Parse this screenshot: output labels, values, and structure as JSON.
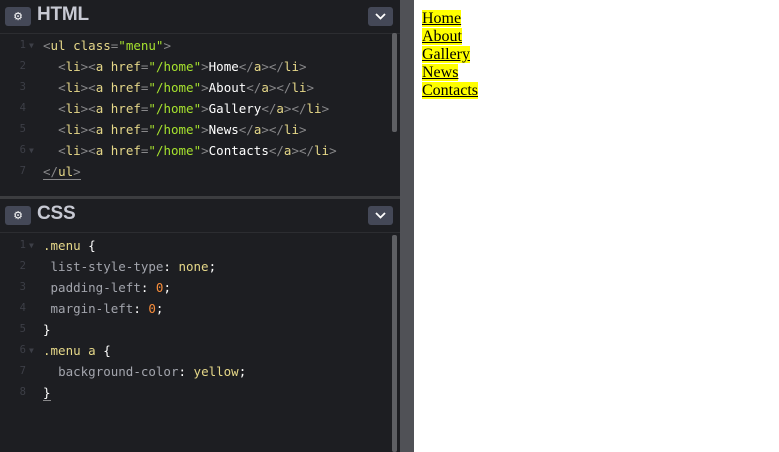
{
  "html_panel": {
    "title": "HTML",
    "gear_icon": "gear-icon",
    "collapse_icon": "chevron-down-icon",
    "line_numbers": [
      "1",
      "2",
      "3",
      "4",
      "5",
      "6",
      "7"
    ],
    "lines": [
      [
        {
          "c": "t-tag",
          "t": "<"
        },
        {
          "c": "t-name",
          "t": "ul"
        },
        {
          "c": "t-text",
          "t": " "
        },
        {
          "c": "t-attr",
          "t": "class"
        },
        {
          "c": "t-eq",
          "t": "="
        },
        {
          "c": "t-str",
          "t": "\"menu\""
        },
        {
          "c": "t-tag",
          "t": ">"
        }
      ],
      [
        {
          "c": "t-text",
          "t": "  "
        },
        {
          "c": "t-tag",
          "t": "<"
        },
        {
          "c": "t-name",
          "t": "li"
        },
        {
          "c": "t-tag",
          "t": "><"
        },
        {
          "c": "t-name",
          "t": "a"
        },
        {
          "c": "t-text",
          "t": " "
        },
        {
          "c": "t-attr",
          "t": "href"
        },
        {
          "c": "t-eq",
          "t": "="
        },
        {
          "c": "t-str",
          "t": "\"/home\""
        },
        {
          "c": "t-tag",
          "t": ">"
        },
        {
          "c": "t-text",
          "t": "Home"
        },
        {
          "c": "t-tag",
          "t": "</"
        },
        {
          "c": "t-name",
          "t": "a"
        },
        {
          "c": "t-tag",
          "t": "></"
        },
        {
          "c": "t-name",
          "t": "li"
        },
        {
          "c": "t-tag",
          "t": ">"
        }
      ],
      [
        {
          "c": "t-text",
          "t": "  "
        },
        {
          "c": "t-tag",
          "t": "<"
        },
        {
          "c": "t-name",
          "t": "li"
        },
        {
          "c": "t-tag",
          "t": "><"
        },
        {
          "c": "t-name",
          "t": "a"
        },
        {
          "c": "t-text",
          "t": " "
        },
        {
          "c": "t-attr",
          "t": "href"
        },
        {
          "c": "t-eq",
          "t": "="
        },
        {
          "c": "t-str",
          "t": "\"/home\""
        },
        {
          "c": "t-tag",
          "t": ">"
        },
        {
          "c": "t-text",
          "t": "About"
        },
        {
          "c": "t-tag",
          "t": "</"
        },
        {
          "c": "t-name",
          "t": "a"
        },
        {
          "c": "t-tag",
          "t": "></"
        },
        {
          "c": "t-name",
          "t": "li"
        },
        {
          "c": "t-tag",
          "t": ">"
        }
      ],
      [
        {
          "c": "t-text",
          "t": "  "
        },
        {
          "c": "t-tag",
          "t": "<"
        },
        {
          "c": "t-name",
          "t": "li"
        },
        {
          "c": "t-tag",
          "t": "><"
        },
        {
          "c": "t-name",
          "t": "a"
        },
        {
          "c": "t-text",
          "t": " "
        },
        {
          "c": "t-attr",
          "t": "href"
        },
        {
          "c": "t-eq",
          "t": "="
        },
        {
          "c": "t-str",
          "t": "\"/home\""
        },
        {
          "c": "t-tag",
          "t": ">"
        },
        {
          "c": "t-text",
          "t": "Gallery"
        },
        {
          "c": "t-tag",
          "t": "</"
        },
        {
          "c": "t-name",
          "t": "a"
        },
        {
          "c": "t-tag",
          "t": "></"
        },
        {
          "c": "t-name",
          "t": "li"
        },
        {
          "c": "t-tag",
          "t": ">"
        }
      ],
      [
        {
          "c": "t-text",
          "t": "  "
        },
        {
          "c": "t-tag",
          "t": "<"
        },
        {
          "c": "t-name",
          "t": "li"
        },
        {
          "c": "t-tag",
          "t": "><"
        },
        {
          "c": "t-name",
          "t": "a"
        },
        {
          "c": "t-text",
          "t": " "
        },
        {
          "c": "t-attr",
          "t": "href"
        },
        {
          "c": "t-eq",
          "t": "="
        },
        {
          "c": "t-str",
          "t": "\"/home\""
        },
        {
          "c": "t-tag",
          "t": ">"
        },
        {
          "c": "t-text",
          "t": "News"
        },
        {
          "c": "t-tag",
          "t": "</"
        },
        {
          "c": "t-name",
          "t": "a"
        },
        {
          "c": "t-tag",
          "t": "></"
        },
        {
          "c": "t-name",
          "t": "li"
        },
        {
          "c": "t-tag",
          "t": ">"
        }
      ],
      [
        {
          "c": "t-text",
          "t": "  "
        },
        {
          "c": "t-tag",
          "t": "<"
        },
        {
          "c": "t-name",
          "t": "li"
        },
        {
          "c": "t-tag",
          "t": "><"
        },
        {
          "c": "t-name",
          "t": "a"
        },
        {
          "c": "t-text",
          "t": " "
        },
        {
          "c": "t-attr",
          "t": "href"
        },
        {
          "c": "t-eq",
          "t": "="
        },
        {
          "c": "t-str",
          "t": "\"/home\""
        },
        {
          "c": "t-tag",
          "t": ">"
        },
        {
          "c": "t-text",
          "t": "Contacts"
        },
        {
          "c": "t-tag",
          "t": "</"
        },
        {
          "c": "t-name",
          "t": "a"
        },
        {
          "c": "t-tag",
          "t": "></"
        },
        {
          "c": "t-name",
          "t": "li"
        },
        {
          "c": "t-tag",
          "t": ">"
        }
      ],
      [
        {
          "c": "t-tag underl",
          "t": "</"
        },
        {
          "c": "t-name underl",
          "t": "ul"
        },
        {
          "c": "t-tag underl",
          "t": ">"
        }
      ]
    ],
    "fold_lines": [
      0,
      5
    ]
  },
  "css_panel": {
    "title": "CSS",
    "gear_icon": "gear-icon",
    "collapse_icon": "chevron-down-icon",
    "line_numbers": [
      "1",
      "2",
      "3",
      "4",
      "5",
      "6",
      "7",
      "8"
    ],
    "lines": [
      [
        {
          "c": "t-sel",
          "t": ".menu"
        },
        {
          "c": "t-text",
          "t": " "
        },
        {
          "c": "t-brace",
          "t": "{"
        }
      ],
      [
        {
          "c": "t-text",
          "t": " "
        },
        {
          "c": "t-prop",
          "t": "list-style-type"
        },
        {
          "c": "t-colon",
          "t": ": "
        },
        {
          "c": "t-val",
          "t": "none"
        },
        {
          "c": "t-semi",
          "t": ";"
        }
      ],
      [
        {
          "c": "t-text",
          "t": " "
        },
        {
          "c": "t-prop",
          "t": "padding-left"
        },
        {
          "c": "t-colon",
          "t": ": "
        },
        {
          "c": "t-num",
          "t": "0"
        },
        {
          "c": "t-semi",
          "t": ";"
        }
      ],
      [
        {
          "c": "t-text",
          "t": " "
        },
        {
          "c": "t-prop",
          "t": "margin-left"
        },
        {
          "c": "t-colon",
          "t": ": "
        },
        {
          "c": "t-num",
          "t": "0"
        },
        {
          "c": "t-semi",
          "t": ";"
        }
      ],
      [
        {
          "c": "t-brace",
          "t": "}"
        }
      ],
      [
        {
          "c": "t-sel",
          "t": ".menu a"
        },
        {
          "c": "t-text",
          "t": " "
        },
        {
          "c": "t-brace",
          "t": "{"
        }
      ],
      [
        {
          "c": "t-text",
          "t": "  "
        },
        {
          "c": "t-prop",
          "t": "background-color"
        },
        {
          "c": "t-colon",
          "t": ": "
        },
        {
          "c": "t-val",
          "t": "yellow"
        },
        {
          "c": "t-semi",
          "t": ";"
        }
      ],
      [
        {
          "c": "t-brace underl",
          "t": "}"
        }
      ]
    ],
    "fold_lines": [
      0,
      5
    ]
  },
  "result": {
    "menu_items": [
      "Home",
      "About",
      "Gallery",
      "News",
      "Contacts"
    ],
    "link_background": "#ffff00"
  },
  "colors": {
    "editor_bg": "#1d1e22",
    "divider": "#505156",
    "button_bg": "#444857"
  }
}
